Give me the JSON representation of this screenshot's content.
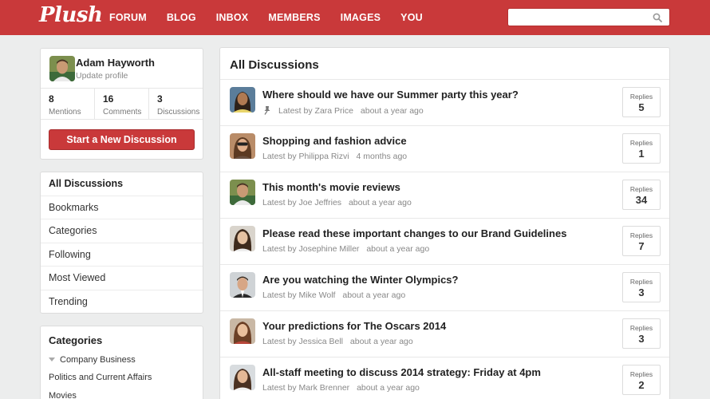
{
  "brand": {
    "logo": "Plush",
    "accent": "#c9393a"
  },
  "nav": [
    {
      "label": "FORUM"
    },
    {
      "label": "BLOG"
    },
    {
      "label": "INBOX"
    },
    {
      "label": "MEMBERS"
    },
    {
      "label": "IMAGES"
    },
    {
      "label": "YOU"
    }
  ],
  "search": {
    "placeholder": "",
    "icon": "search-icon"
  },
  "profile": {
    "name": "Adam Hayworth",
    "update_link": "Update profile",
    "stats": [
      {
        "value": "8",
        "label": "Mentions"
      },
      {
        "value": "16",
        "label": "Comments"
      },
      {
        "value": "3",
        "label": "Discussions"
      }
    ],
    "new_discussion_label": "Start a New Discussion"
  },
  "menu": [
    {
      "label": "All Discussions"
    },
    {
      "label": "Bookmarks"
    },
    {
      "label": "Categories"
    },
    {
      "label": "Following"
    },
    {
      "label": "Most Viewed"
    },
    {
      "label": "Trending"
    }
  ],
  "categories": {
    "title": "Categories",
    "items": [
      {
        "label": "Company Business"
      },
      {
        "label": "Politics and Current Affairs"
      },
      {
        "label": "Movies"
      }
    ]
  },
  "discussions": {
    "title": "All Discussions",
    "replies_label": "Replies",
    "latest_by_prefix": "Latest by",
    "items": [
      {
        "title": "Where should we have our Summer party this year?",
        "author": "Zara Price",
        "time": "about a year ago",
        "replies": "5",
        "pinned": true
      },
      {
        "title": "Shopping and fashion advice",
        "author": "Philippa Rizvi",
        "time": "4 months ago",
        "replies": "1",
        "pinned": false
      },
      {
        "title": "This month's movie reviews",
        "author": "Joe Jeffries",
        "time": "about a year ago",
        "replies": "34",
        "pinned": false
      },
      {
        "title": "Please read these important changes to our Brand Guidelines",
        "author": "Josephine Miller",
        "time": "about a year ago",
        "replies": "7",
        "pinned": false
      },
      {
        "title": "Are you watching the Winter Olympics?",
        "author": "Mike Wolf",
        "time": "about a year ago",
        "replies": "3",
        "pinned": false
      },
      {
        "title": "Your predictions for The Oscars 2014",
        "author": "Jessica Bell",
        "time": "about a year ago",
        "replies": "3",
        "pinned": false
      },
      {
        "title": "All-staff meeting to discuss 2014 strategy: Friday at 4pm",
        "author": "Mark Brenner",
        "time": "about a year ago",
        "replies": "2",
        "pinned": false
      }
    ]
  }
}
